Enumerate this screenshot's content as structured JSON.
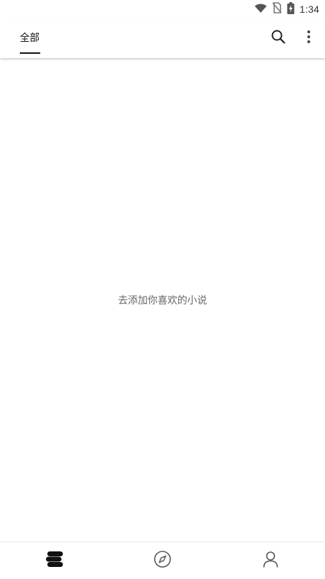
{
  "status_bar": {
    "time": "1:34",
    "icons": [
      "wifi-icon",
      "no-sim-icon",
      "battery-charging-icon"
    ]
  },
  "app_bar": {
    "tabs": [
      {
        "label": "全部",
        "active": true
      }
    ],
    "actions": [
      "search-icon",
      "more-vert-icon"
    ]
  },
  "content": {
    "empty_message": "去添加你喜欢的小说"
  },
  "bottom_nav": {
    "items": [
      {
        "icon": "bookshelf-icon",
        "active": true
      },
      {
        "icon": "compass-icon",
        "active": false
      },
      {
        "icon": "person-icon",
        "active": false
      }
    ]
  },
  "colors": {
    "accent": "#111111",
    "inactive_icon": "#555555",
    "empty_text": "#666666",
    "background": "#ffffff"
  }
}
